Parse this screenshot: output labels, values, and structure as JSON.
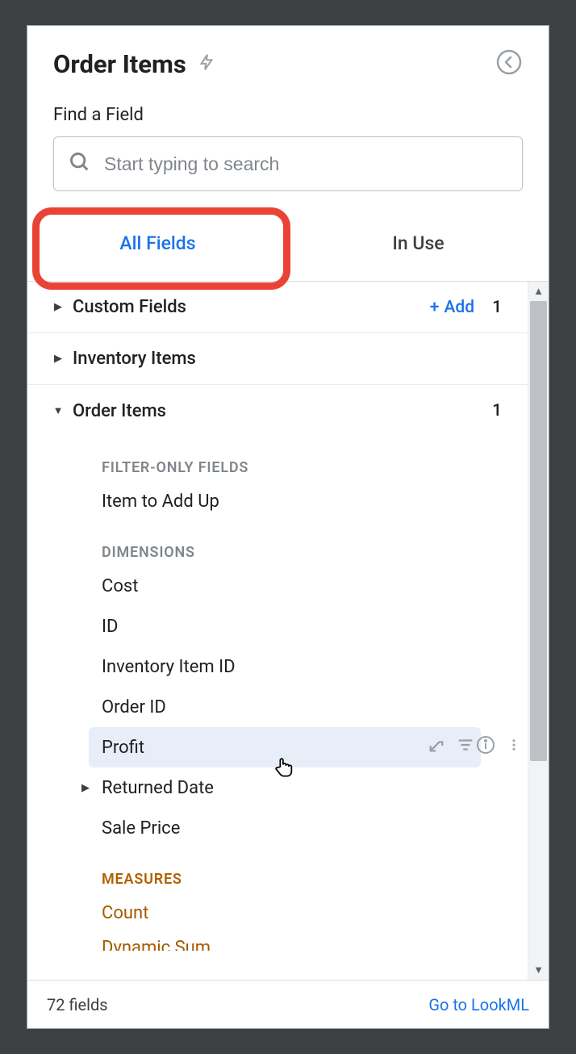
{
  "header": {
    "title": "Order Items"
  },
  "search": {
    "label": "Find a Field",
    "placeholder": "Start typing to search"
  },
  "tabs": {
    "all_fields": "All Fields",
    "in_use": "In Use"
  },
  "groups": {
    "custom_fields": {
      "name": "Custom Fields",
      "add_label": "Add",
      "count": "1"
    },
    "inventory_items": {
      "name": "Inventory Items"
    },
    "order_items": {
      "name": "Order Items",
      "count": "1",
      "sections": {
        "filter_only": {
          "label": "FILTER-ONLY FIELDS",
          "fields": [
            "Item to Add Up"
          ]
        },
        "dimensions": {
          "label": "DIMENSIONS",
          "fields": [
            "Cost",
            "ID",
            "Inventory Item ID",
            "Order ID",
            "Profit",
            "Returned Date",
            "Sale Price"
          ]
        },
        "measures": {
          "label": "MEASURES",
          "fields": [
            "Count"
          ]
        }
      }
    }
  },
  "hovered_field": "Profit",
  "cutoff_field": "Dynamic Sum",
  "footer": {
    "count": "72 fields",
    "link": "Go to LookML"
  }
}
